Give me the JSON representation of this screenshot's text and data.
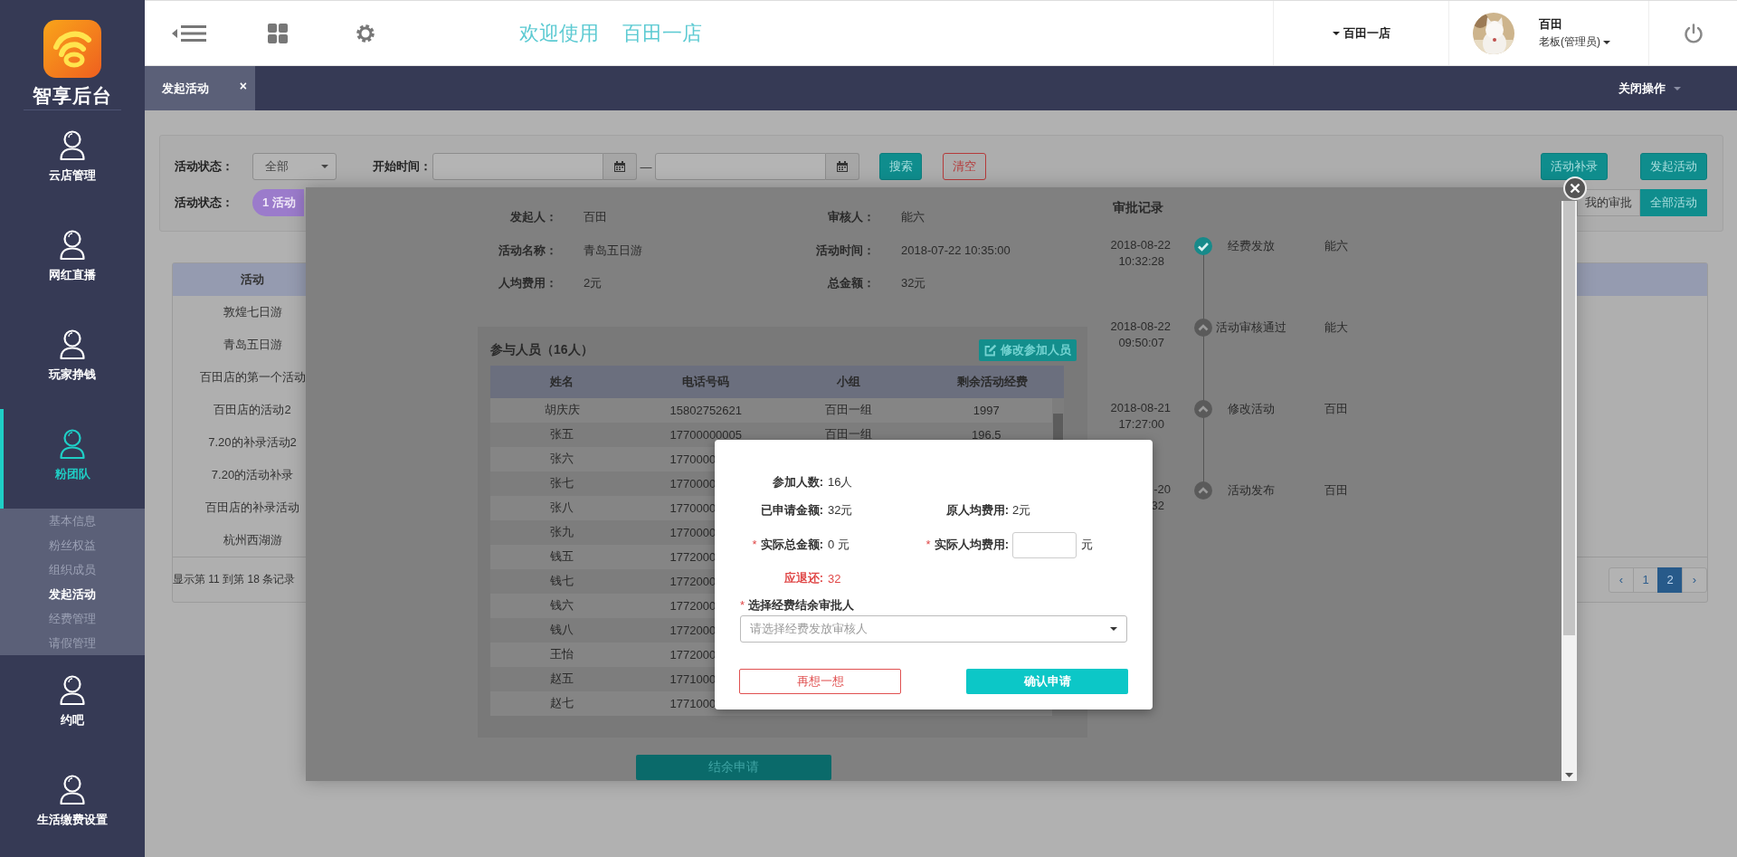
{
  "sidebar": {
    "logo_text": "智享后台",
    "items": [
      {
        "label": "云店管理",
        "selected": false
      },
      {
        "label": "网红直播",
        "selected": false
      },
      {
        "label": "玩家挣钱",
        "selected": false
      },
      {
        "label": "粉团队",
        "selected": true,
        "children": [
          {
            "label": "基本信息",
            "selected": false
          },
          {
            "label": "粉丝权益",
            "selected": false
          },
          {
            "label": "组织成员",
            "selected": false
          },
          {
            "label": "发起活动",
            "selected": true
          },
          {
            "label": "经费管理",
            "selected": false
          },
          {
            "label": "请假管理",
            "selected": false
          }
        ]
      },
      {
        "label": "约吧",
        "selected": false
      },
      {
        "label": "生活缴费设置",
        "selected": false
      }
    ]
  },
  "header": {
    "welcome": "欢迎使用",
    "store_title": "百田一店",
    "store_switch": "百田一店",
    "user": {
      "name": "百田",
      "role": "老板(管理员)"
    }
  },
  "tabs": [
    {
      "label": "发起活动",
      "selected": true,
      "close": "×"
    }
  ],
  "close_menu": "关闭操作",
  "filters": {
    "status_label": "活动状态：",
    "status_select": "全部",
    "time_label": "开始时间：",
    "range_separator": "—",
    "search_button": "搜索",
    "clear_button": "清空",
    "supplement_button": "活动补录",
    "create_button": "发起活动",
    "status_label_2": "活动状态：",
    "status_step": "1 活动",
    "view_tabs": [
      {
        "label": "我的审批",
        "selected": false
      },
      {
        "label": "全部活动",
        "selected": true
      }
    ]
  },
  "activity_table": {
    "columns": [
      "活动"
    ],
    "rows": [
      "敦煌七日游",
      "青岛五日游",
      "百田店的第一个活动",
      "百田店的活动2",
      "7.20的补录活动2",
      "7.20的活动补录",
      "百田店的补录活动",
      "杭州西湖游"
    ],
    "footer": "显示第 11 到第 18 条记录",
    "pagination": [
      {
        "label": "‹",
        "selected": false
      },
      {
        "label": "1",
        "selected": false
      },
      {
        "label": "2",
        "selected": true
      },
      {
        "label": "›",
        "selected": false
      }
    ]
  },
  "detail_modal": {
    "info": [
      {
        "label": "发起人：",
        "value": "百田"
      },
      {
        "label": "审核人：",
        "value": "能六"
      },
      {
        "label": "活动名称：",
        "value": "青岛五日游"
      },
      {
        "label": "活动时间：",
        "value": "2018-07-22 10:35:00"
      },
      {
        "label": "人均费用：",
        "value": "2元"
      },
      {
        "label": "总金额：",
        "value": "32元"
      }
    ],
    "participants": {
      "title": "参与人员（16人）",
      "edit_button": "修改参加人员",
      "columns": [
        "姓名",
        "电话号码",
        "小组",
        "剩余活动经费"
      ],
      "rows": [
        [
          "胡庆庆",
          "15802752621",
          "百田一组",
          "1997"
        ],
        [
          "张五",
          "17700000005",
          "百田一组",
          "196.5"
        ],
        [
          "张六",
          "1770000"
        ],
        [
          "张七",
          "1770000"
        ],
        [
          "张八",
          "1770000"
        ],
        [
          "张九",
          "1770000"
        ],
        [
          "钱五",
          "1772000"
        ],
        [
          "钱七",
          "1772000"
        ],
        [
          "钱六",
          "1772000"
        ],
        [
          "钱八",
          "1772000"
        ],
        [
          "王怡",
          "1772000"
        ],
        [
          "赵五",
          "1771000"
        ],
        [
          "赵七",
          "1771000"
        ]
      ]
    },
    "submit_button": "结余申请",
    "approval": {
      "title": "审批记录",
      "records": [
        {
          "date": "2018-08-22",
          "time": "10:32:28",
          "event": "经费发放",
          "person": "能六",
          "kind": "done"
        },
        {
          "date": "2018-08-22",
          "time": "09:50:07",
          "event": "活动审核通过",
          "person": "能大",
          "kind": "pending"
        },
        {
          "date": "2018-08-21",
          "time": "17:27:00",
          "event": "修改活动",
          "person": "百田",
          "kind": "pending"
        },
        {
          "date": "-20",
          "time": "32",
          "event": "活动发布",
          "person": "百田",
          "kind": "pending"
        }
      ]
    }
  },
  "settle_dialog": {
    "required_mark": "*",
    "count": {
      "label": "参加人数:",
      "value": "16人"
    },
    "applied": {
      "label": "已申请金额:",
      "value": "32元"
    },
    "original_avg": {
      "label": "原人均费用:",
      "value": "2元"
    },
    "actual_total": {
      "label": "实际总金额:",
      "value": "0 元",
      "required": true
    },
    "actual_avg": {
      "label": "实际人均费用:",
      "unit": "元",
      "required": true
    },
    "refund": {
      "label": "应退还:",
      "value": "32"
    },
    "approver": {
      "label": "选择经费结余审批人",
      "placeholder": "请选择经费发放审核人",
      "required": true
    },
    "cancel_button": "再想一想",
    "confirm_button": "确认申请"
  }
}
